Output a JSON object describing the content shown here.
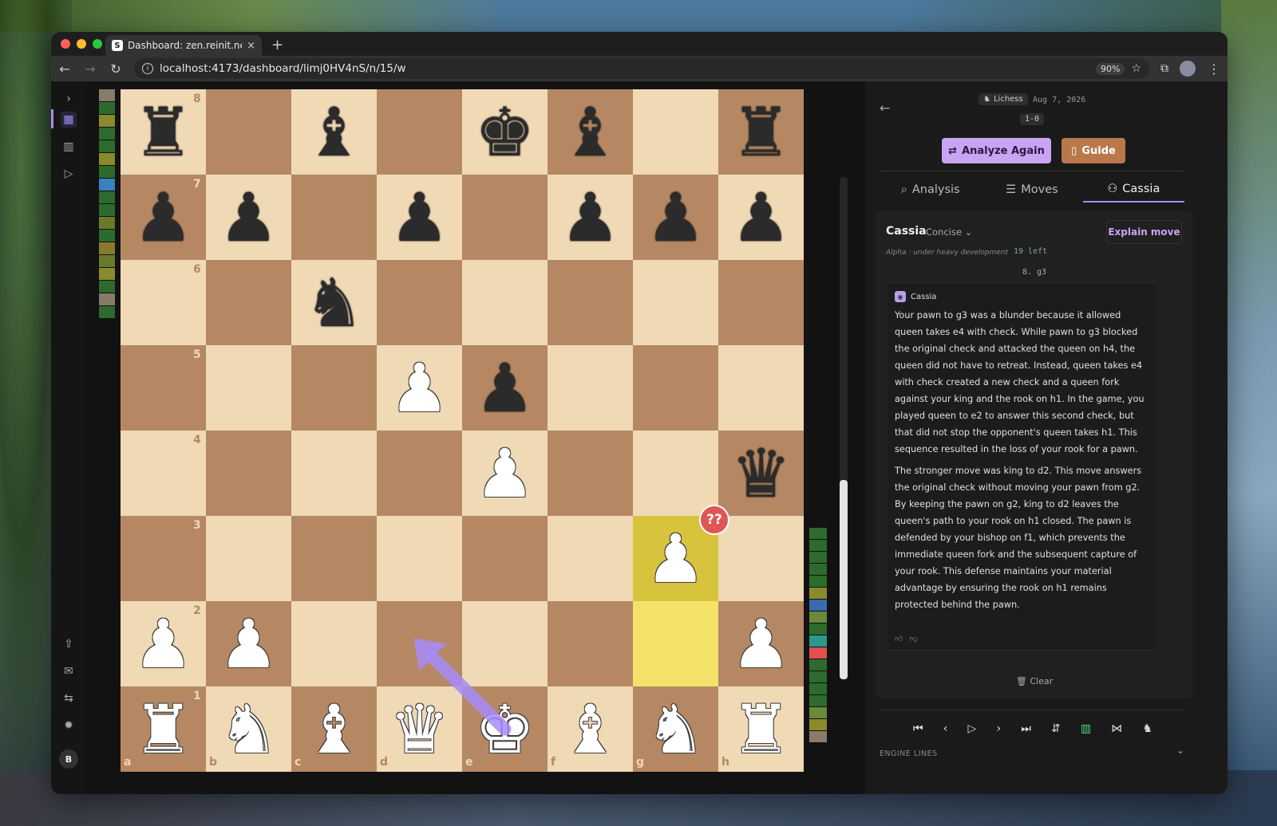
{
  "browser": {
    "tab_title": "Dashboard: zen.reinit.ne",
    "tab_favicon": "S",
    "new_tab": "+",
    "close": "×",
    "url": "localhost:4173/dashboard/limj0HV4nS/n/15/w",
    "zoom": "90%"
  },
  "sidebar": {
    "items": [
      {
        "icon": "chevron-right-icon",
        "glyph": "›"
      },
      {
        "icon": "grid-icon",
        "glyph": "▦"
      },
      {
        "icon": "chart-icon",
        "glyph": "▥"
      },
      {
        "icon": "play-icon",
        "glyph": "▷"
      },
      {
        "icon": "upload-icon",
        "glyph": "⇪"
      },
      {
        "icon": "mail-icon",
        "glyph": "✉"
      },
      {
        "icon": "sliders-icon",
        "glyph": "⇆"
      },
      {
        "icon": "settings-icon",
        "glyph": "✹"
      }
    ],
    "avatar": "B"
  },
  "board": {
    "files": [
      "a",
      "b",
      "c",
      "d",
      "e",
      "f",
      "g",
      "h"
    ],
    "ranks": [
      "8",
      "7",
      "6",
      "5",
      "4",
      "3",
      "2",
      "1"
    ],
    "pieces": [
      "r . b . k b . r",
      "p p . p . p p p",
      ". . n . . . . .",
      ". . . P p . . .",
      ". . . . P . . q",
      ". . . . . . P .",
      "P P . . . . . P",
      "R N B Q K B N R"
    ],
    "highlight": [
      "g3",
      "g2"
    ],
    "blunder_square": "g3",
    "blunder_label": "??",
    "arrow": {
      "from": "e1",
      "to": "d2",
      "color": "#a78bfa"
    }
  },
  "eval_left_colors": [
    "#8a7a6a",
    "#2d6a2d",
    "#8a8a2d",
    "#2d6a2d",
    "#2d6a2d",
    "#8a8a2d",
    "#2d6a2d",
    "#3a80c0",
    "#2d6a2d",
    "#2d6a2d",
    "#6a7a2d",
    "#2d6a2d",
    "#8a7a2d",
    "#6a7a2d",
    "#8a8a2d",
    "#2d6a2d",
    "#8a7a6a",
    "#2d6a2d"
  ],
  "eval_right_colors": [
    "#2d6a2d",
    "#2d6a2d",
    "#2d6a2d",
    "#2d6a2d",
    "#2d6a2d",
    "#8a8a2d",
    "#3a6ab0",
    "#6a8a3a",
    "#2d6a2d",
    "#2a9a8a",
    "#e05050",
    "#2d6a2d",
    "#2d6a2d",
    "#2d6a2d",
    "#2d6a2d",
    "#6a8a3a",
    "#8a8a2d",
    "#8a7a6a"
  ],
  "panel": {
    "source": "Lichess",
    "date": "Aug 7, 2026",
    "result": "1-0",
    "analyze_again": "Analyze Again",
    "guide": "Guide",
    "tabs": [
      {
        "label": "Analysis",
        "icon": "search-icon",
        "glyph": "⌕"
      },
      {
        "label": "Moves",
        "icon": "list-icon",
        "glyph": "☰"
      },
      {
        "label": "Cassia",
        "icon": "bot-icon",
        "glyph": "⚇"
      }
    ],
    "cassia": {
      "title": "Cassia",
      "mode": "Concise ⌄",
      "explain_move": "Explain move",
      "subtitle": "Alpha · under heavy development",
      "left": "19 left",
      "move": "8. g3",
      "bot_name": "Cassia",
      "paragraph1": "Your pawn to g3 was a blunder because it allowed queen takes e4 with check. While pawn to g3 blocked the original check and attacked the queen on h4, the queen did not have to retreat. Instead, queen takes e4 with check created a new check and a queen fork against your king and the rook on h1. In the game, you played queen to e2 to answer this second check, but that did not stop the opponent's queen takes h1. This sequence resulted in the loss of your rook for a pawn.",
      "paragraph2": "The stronger move was king to d2. This move answers the original check without moving your pawn from g2. By keeping the pawn on g2, king to d2 leaves the queen's path to your rook on h1 closed. The pawn is defended by your bishop on f1, which prevents the immediate queen fork and the subsequent capture of your rook. This defense maintains your material advantage by ensuring the rook on h1 remains protected behind the pawn.",
      "clear": "Clear"
    },
    "engine_lines": "ENGINE LINES"
  }
}
